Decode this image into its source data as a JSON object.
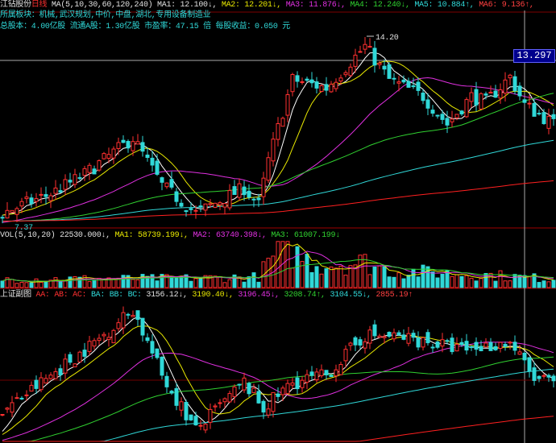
{
  "header": {
    "stock": "江钻股份",
    "period": "日线",
    "ma_label": "MA(5,10,30,60,120,240)",
    "ma": [
      "MA1: 12.100↓,",
      "MA2: 12.201↓,",
      "MA3: 11.876↓,",
      "MA4: 12.240↓,",
      "MA5: 10.884↑,",
      "MA6: 9.136↑,"
    ],
    "sector": "所属板块：机械,武汉规划,中价,中盘,湖北,专用设备制造业",
    "info": "总股本：4.00亿股  流通A股：1.30亿股  市盈率：47.15 倍  每股收益：0.050 元"
  },
  "volume_header": {
    "label": "VOL(5,10,20)",
    "value": "22530.000↓,",
    "ma": [
      "MA1: 58739.199↓,",
      "MA2: 63740.398↓,",
      "MA3: 61007.199↓"
    ]
  },
  "index_header": {
    "label": "上证副图",
    "tags": [
      "AA:",
      "AB:",
      "AC:"
    ],
    "tags2": [
      "BA:",
      "BB:",
      "BC:"
    ],
    "values": [
      "3156.12↓,",
      "3190.40↓,",
      "3196.45↓,",
      "3208.74↑,",
      "3104.55↓,",
      "2855.19↑"
    ]
  },
  "price_high_label": "14.20",
  "price_low_label": "7.37",
  "crosshair_price": "13.297",
  "colors": {
    "up": "#ff3030",
    "down": "#30d8d8",
    "ma": [
      "#ffffff",
      "#e8e800",
      "#e030e0",
      "#30d030",
      "#30d8d8",
      "#ff2020"
    ]
  },
  "chart_data": {
    "type": "candlestick",
    "bars": 115,
    "price_range": [
      7.37,
      14.2
    ],
    "close_keyframes": [
      [
        0,
        7.9
      ],
      [
        10,
        8.6
      ],
      [
        17,
        9.3
      ],
      [
        27,
        10.6
      ],
      [
        33,
        8.9
      ],
      [
        40,
        7.9
      ],
      [
        50,
        8.8
      ],
      [
        53,
        8.2
      ],
      [
        55,
        9.8
      ],
      [
        60,
        12.7
      ],
      [
        67,
        12.4
      ],
      [
        75,
        13.9
      ],
      [
        80,
        12.7
      ],
      [
        87,
        12.1
      ],
      [
        92,
        11.1
      ],
      [
        97,
        12.1
      ],
      [
        100,
        11.9
      ],
      [
        105,
        12.8
      ],
      [
        108,
        11.8
      ],
      [
        114,
        11.1
      ]
    ],
    "volume_keyframes": [
      [
        0,
        20
      ],
      [
        40,
        22
      ],
      [
        53,
        25
      ],
      [
        55,
        60
      ],
      [
        58,
        95
      ],
      [
        65,
        55
      ],
      [
        75,
        60
      ],
      [
        80,
        40
      ],
      [
        100,
        30
      ],
      [
        114,
        20
      ]
    ],
    "index_keyframes": [
      [
        0,
        3050
      ],
      [
        10,
        3150
      ],
      [
        20,
        3250
      ],
      [
        27,
        3330
      ],
      [
        33,
        3150
      ],
      [
        40,
        3000
      ],
      [
        50,
        3130
      ],
      [
        54,
        3060
      ],
      [
        60,
        3130
      ],
      [
        67,
        3150
      ],
      [
        75,
        3260
      ],
      [
        85,
        3250
      ],
      [
        95,
        3220
      ],
      [
        105,
        3240
      ],
      [
        110,
        3140
      ],
      [
        114,
        3130
      ]
    ]
  }
}
